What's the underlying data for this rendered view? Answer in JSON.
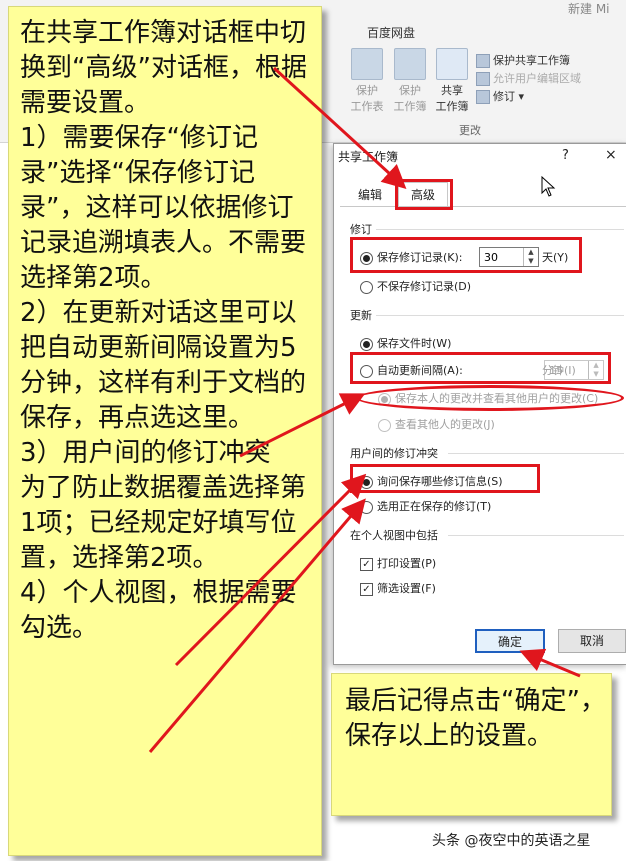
{
  "window": {
    "title_fragment": "新建 Mi"
  },
  "ribbon": {
    "tab_fragment": "",
    "tab_baidu": "百度网盘",
    "protect_sheet": [
      "保护",
      "工作表"
    ],
    "protect_workbook": [
      "保护",
      "工作簿"
    ],
    "share_workbook": [
      "共享",
      "工作簿"
    ],
    "protect_shared_workbook": "保护共享工作簿",
    "allow_edit_ranges": "允许用户编辑区域",
    "track_changes": "修订 ▾",
    "group_label": "更改"
  },
  "dialog": {
    "title": "共享工作簿",
    "help": "?",
    "close": "×",
    "tabs": {
      "edit": "编辑",
      "advanced": "高级"
    },
    "revisions": {
      "heading": "修订",
      "keep_history": "保存修订记录(K):",
      "keep_days": "30",
      "days_unit": "天(Y)",
      "no_history": "不保存修订记录(D)"
    },
    "update": {
      "heading": "更新",
      "on_save": "保存文件时(W)",
      "auto_every": "自动更新间隔(A):",
      "minutes": "15",
      "minutes_unit": "分钟(I)",
      "save_and_see": "保存本人的更改并查看其他用户的更改(C)",
      "just_see": "查看其他人的更改(J)"
    },
    "conflicts": {
      "heading": "用户间的修订冲突",
      "ask": "询问保存哪些修订信息(S)",
      "win": "选用正在保存的修订(T)"
    },
    "personal_view": {
      "heading": "在个人视图中包括",
      "print": "打印设置(P)",
      "filter": "筛选设置(F)"
    },
    "ok": "确定",
    "cancel": "取消"
  },
  "notes": {
    "left": "在共享工作簿对话框中切换到“高级”对话框，根据需要设置。\n1）需要保存“修订记录”选择“保存修订记录”，这样可以依据修订记录追溯填表人。不需要选择第2项。\n2）在更新对话这里可以把自动更新间隔设置为5分钟，这样有利于文档的保存，再点选这里。\n3）用户间的修订冲突\n为了防止数据覆盖选择第1项；已经规定好填写位置，选择第2项。\n4）个人视图，根据需要勾选。",
    "right": "最后记得点击“确定”，保存以上的设置。"
  },
  "watermark": "头条 @夜空中的英语之星",
  "colors": {
    "note": "#ffff99",
    "highlight": "#e0161d",
    "ok_border": "#1f5fbf"
  }
}
